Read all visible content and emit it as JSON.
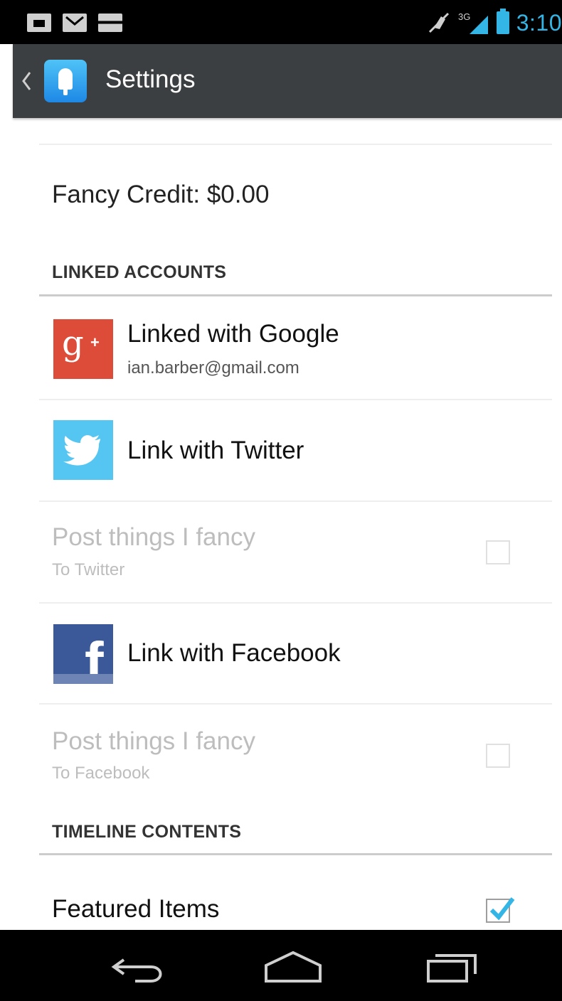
{
  "status_bar": {
    "time": "3:10",
    "network": "3G",
    "accent_color": "#33b5e5",
    "notification_icons": [
      "calendar-icon",
      "gmail-icon",
      "message-icon"
    ]
  },
  "action_bar": {
    "title": "Settings",
    "background": "#3c3f41"
  },
  "settings": {
    "credit": "Fancy Credit: $0.00",
    "linked_accounts": {
      "header": "LINKED ACCOUNTS",
      "google": {
        "title": "Linked with Google",
        "subtitle": "ian.barber@gmail.com",
        "color": "#dd4b39"
      },
      "twitter": {
        "title": "Link with Twitter",
        "color": "#55c6f2"
      },
      "post_twitter": {
        "title": "Post things I fancy",
        "subtitle": "To Twitter",
        "checked": false,
        "enabled": false
      },
      "facebook": {
        "title": "Link with Facebook",
        "color": "#3b5998"
      },
      "post_facebook": {
        "title": "Post things I fancy",
        "subtitle": "To Facebook",
        "checked": false,
        "enabled": false
      }
    },
    "timeline": {
      "header": "TIMELINE CONTENTS",
      "featured": {
        "title": "Featured Items",
        "checked": true
      }
    }
  },
  "nav_bar": {
    "buttons": [
      "back-icon",
      "home-icon",
      "recent-apps-icon"
    ]
  }
}
